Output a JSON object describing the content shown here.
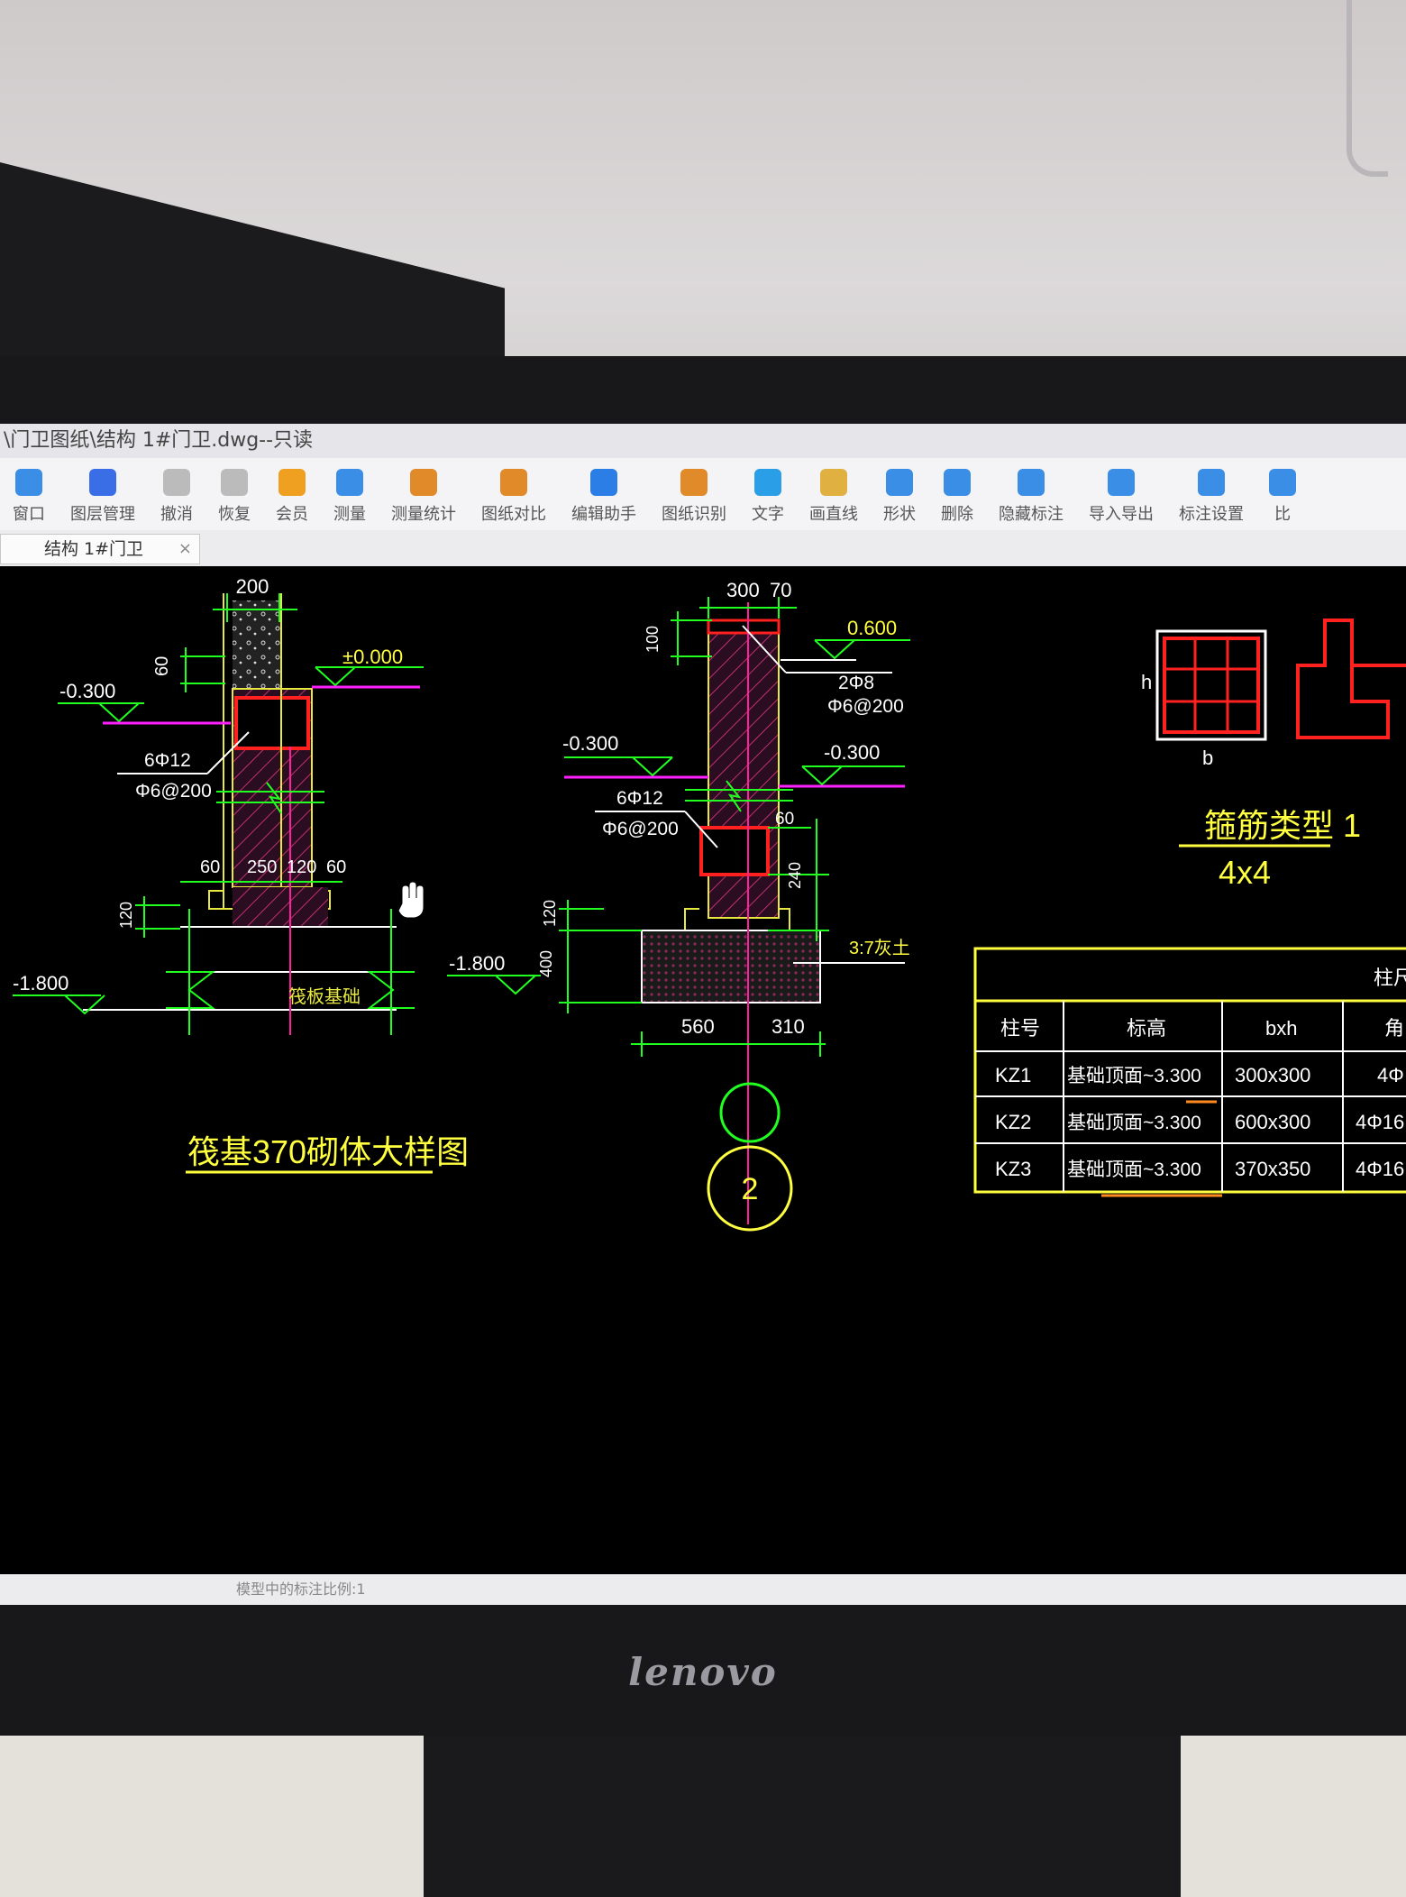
{
  "window": {
    "title": "\\门卫图纸\\结构 1#门卫.dwg--只读"
  },
  "ribbon": {
    "tools": [
      {
        "label": "窗口",
        "icon": "window-icon",
        "color": "#3a8ee6"
      },
      {
        "label": "图层管理",
        "icon": "layers-icon",
        "color": "#3a6ee6"
      },
      {
        "label": "撤消",
        "icon": "undo-icon",
        "color": "#bbbbbb"
      },
      {
        "label": "恢复",
        "icon": "redo-icon",
        "color": "#bbbbbb"
      },
      {
        "label": "会员",
        "icon": "vip-icon",
        "color": "#f0a020"
      },
      {
        "label": "测量",
        "icon": "measure-icon",
        "color": "#3a8ee6"
      },
      {
        "label": "测量统计",
        "icon": "measure-stats-icon",
        "color": "#e08a2a"
      },
      {
        "label": "图纸对比",
        "icon": "compare-icon",
        "color": "#e08a2a"
      },
      {
        "label": "编辑助手",
        "icon": "edit-assistant-icon",
        "color": "#2a7ee6"
      },
      {
        "label": "图纸识别",
        "icon": "recognize-icon",
        "color": "#e08a2a"
      },
      {
        "label": "文字",
        "icon": "text-icon",
        "color": "#2a9ee6"
      },
      {
        "label": "画直线",
        "icon": "line-icon",
        "color": "#e0b040"
      },
      {
        "label": "形状",
        "icon": "shape-icon",
        "color": "#3a8ee6"
      },
      {
        "label": "删除",
        "icon": "eraser-icon",
        "color": "#3a8ee6"
      },
      {
        "label": "隐藏标注",
        "icon": "hide-annotation-icon",
        "color": "#3a8ee6"
      },
      {
        "label": "导入导出",
        "icon": "import-export-icon",
        "color": "#3a8ee6"
      },
      {
        "label": "标注设置",
        "icon": "annotation-settings-icon",
        "color": "#3a8ee6"
      },
      {
        "label": "比",
        "icon": "ratio-icon",
        "color": "#3a8ee6"
      }
    ]
  },
  "tabs": [
    {
      "label": "结构 1#门卫",
      "close": "×"
    }
  ],
  "drawing": {
    "left_detail": {
      "dim_top": "200",
      "level_0": "±0.000",
      "level_m0300": "-0.300",
      "dim_60": "60",
      "rebar_main": "6Φ12",
      "rebar_stirrup": "Φ6@200",
      "dims_bottom": [
        "60",
        "250",
        "120",
        "60"
      ],
      "dim_120": "120",
      "foundation_label": "筏板基础",
      "level_m1800": "-1.800",
      "title": "筏基370砌体大样图"
    },
    "middle_detail": {
      "dim_300": "300",
      "dim_70": "70",
      "level_0600": "0.600",
      "dim_100": "100",
      "rebar_top": "2Φ8",
      "stirrup_top": "Φ6@200",
      "level_m0300_left": "-0.300",
      "level_m0300_right": "-0.300",
      "rebar_main": "6Φ12",
      "rebar_stirrup": "Φ6@200",
      "dim_60": "60",
      "dim_240": "240",
      "dim_120": "120",
      "dim_400": "400",
      "level_m1800": "-1.800",
      "soil_label": "3:7灰土",
      "dim_560": "560",
      "dim_310": "310",
      "section_marker": "2"
    },
    "stirrup_legend": {
      "h": "h",
      "b": "b",
      "title": "箍筋类型 1",
      "subtitle": "4x4"
    },
    "column_table": {
      "header_title": "柱尺",
      "columns": [
        "柱号",
        "标高",
        "bxh",
        "角"
      ],
      "rows": [
        [
          "KZ1",
          "基础顶面~3.300",
          "300x300",
          "4Φ"
        ],
        [
          "KZ2",
          "基础顶面~3.300",
          "600x300",
          "4Φ16"
        ],
        [
          "KZ3",
          "基础顶面~3.300",
          "370x350",
          "4Φ16"
        ]
      ]
    }
  },
  "status": {
    "text": "模型中的标注比例:1"
  },
  "monitor": {
    "brand": "lenovo"
  }
}
